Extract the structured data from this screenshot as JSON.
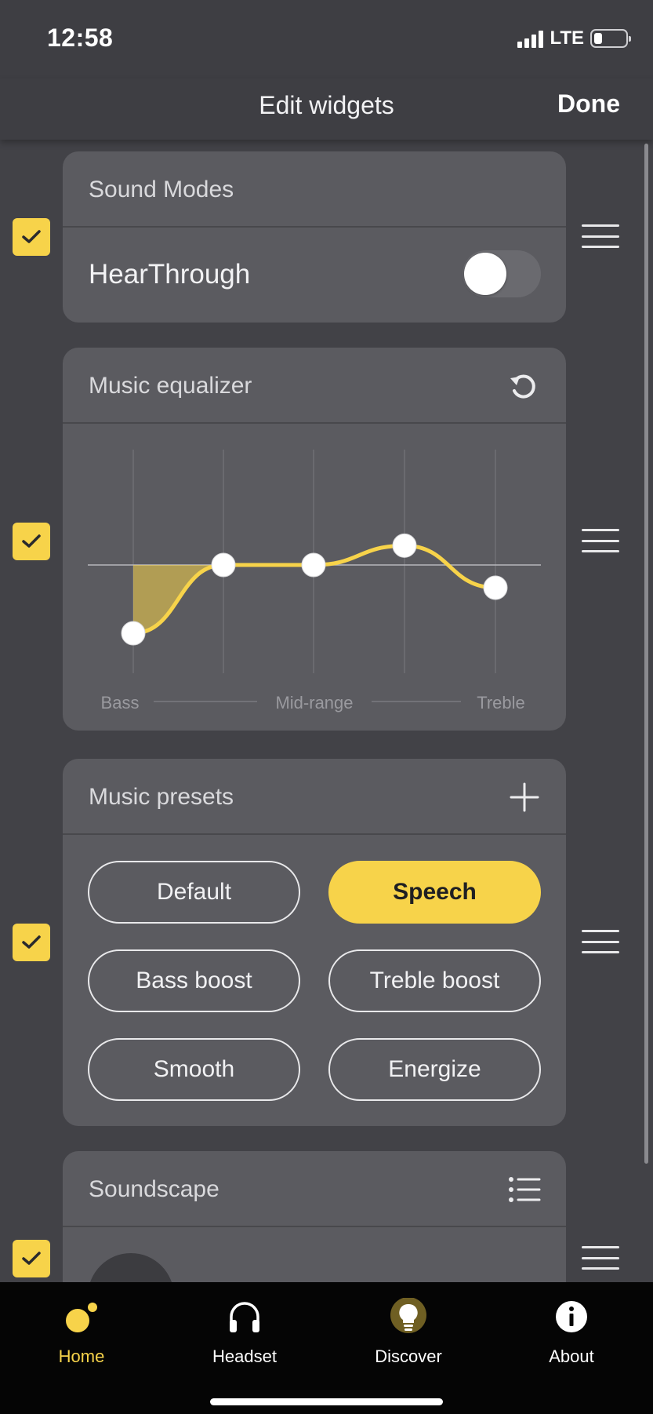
{
  "status_bar": {
    "time": "12:58",
    "network": "LTE"
  },
  "header": {
    "title": "Edit widgets",
    "done_label": "Done"
  },
  "widgets": {
    "sound_modes": {
      "title": "Sound Modes",
      "row_label": "HearThrough",
      "toggle_on": false,
      "checked": true
    },
    "music_equalizer": {
      "title": "Music equalizer",
      "checked": true,
      "labels": {
        "bass": "Bass",
        "mid": "Mid-range",
        "treble": "Treble"
      },
      "bands": [
        {
          "name": "band-1",
          "level": -0.6
        },
        {
          "name": "band-2",
          "level": 0
        },
        {
          "name": "band-3",
          "level": 0
        },
        {
          "name": "band-4",
          "level": 0.17
        },
        {
          "name": "band-5",
          "level": -0.2
        }
      ]
    },
    "music_presets": {
      "title": "Music presets",
      "checked": true,
      "presets": [
        {
          "label": "Default",
          "selected": false
        },
        {
          "label": "Speech",
          "selected": true
        },
        {
          "label": "Bass boost",
          "selected": false
        },
        {
          "label": "Treble boost",
          "selected": false
        },
        {
          "label": "Smooth",
          "selected": false
        },
        {
          "label": "Energize",
          "selected": false
        }
      ]
    },
    "soundscape": {
      "title": "Soundscape",
      "checked": true
    }
  },
  "tabs": [
    {
      "label": "Home",
      "icon": "home-icon",
      "active": true
    },
    {
      "label": "Headset",
      "icon": "headphones-icon",
      "active": false
    },
    {
      "label": "Discover",
      "icon": "lightbulb-icon",
      "active": false
    },
    {
      "label": "About",
      "icon": "info-icon",
      "active": false
    }
  ],
  "colors": {
    "accent": "#f7d34a",
    "card": "#5b5b60",
    "background": "#424247",
    "tab_bar": "#050505",
    "active_tab": "#f7d34a",
    "inactive_tab": "#ffffff"
  }
}
